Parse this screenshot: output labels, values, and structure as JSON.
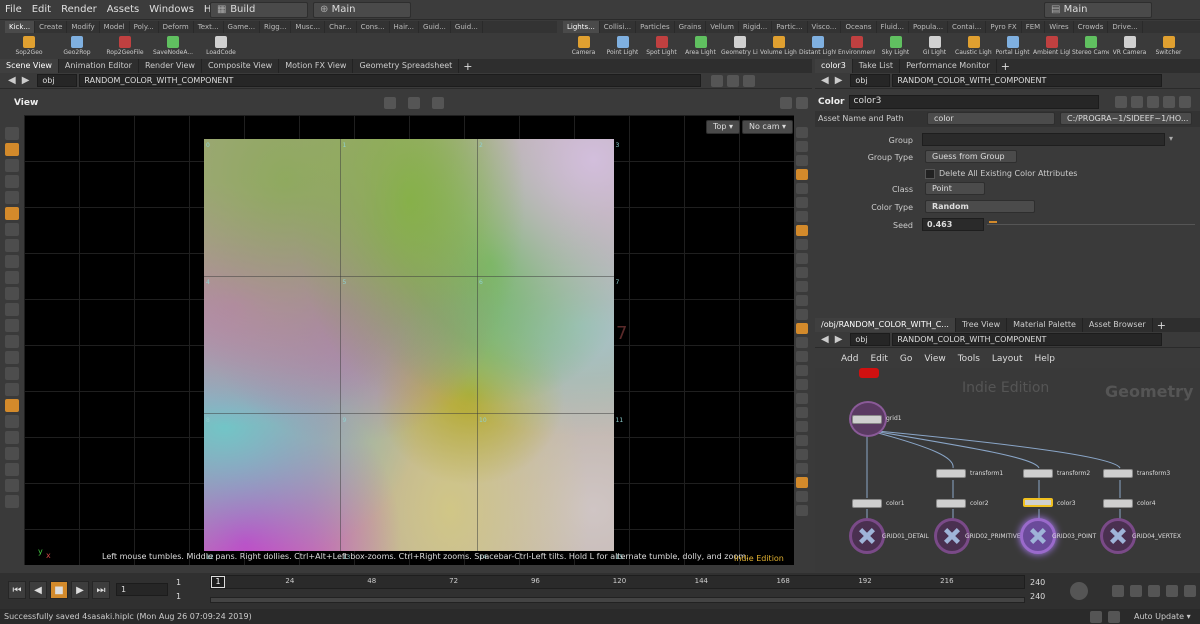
{
  "menu": [
    "File",
    "Edit",
    "Render",
    "Assets",
    "Windows",
    "Help"
  ],
  "desktop": "Build",
  "context": "Main",
  "right_context": "Main",
  "shelf_left": {
    "tabs": [
      "Kick...",
      "Create",
      "Modify",
      "Model",
      "Poly...",
      "Deform",
      "Text...",
      "Game...",
      "Rigg...",
      "Musc...",
      "Char...",
      "Cons...",
      "Hair...",
      "Guid...",
      "Guid..."
    ],
    "tools": [
      "Sop2Geo",
      "Geo2Rop",
      "Rop2GeoFile",
      "SaveNodeA...",
      "LoadCode"
    ]
  },
  "shelf_right": {
    "tabs": [
      "Lights...",
      "Collisi...",
      "Particles",
      "Grains",
      "Vellum",
      "Rigid...",
      "Partic...",
      "Visco...",
      "Oceans",
      "Fluid...",
      "Popula...",
      "Contai...",
      "Pyro FX",
      "FEM",
      "Wires",
      "Crowds",
      "Drive..."
    ],
    "tools": [
      "Camera",
      "Point Light",
      "Spot Light",
      "Area Light",
      "Geometry Light",
      "Volume Light",
      "Distant Light",
      "Environment Light",
      "Sky Light",
      "GI Light",
      "Caustic Light",
      "Portal Light",
      "Ambient Light",
      "Stereo Camera",
      "VR Camera",
      "Switcher"
    ]
  },
  "viewport_tabs": [
    "Scene View",
    "Animation Editor",
    "Render View",
    "Composite View",
    "Motion FX View",
    "Geometry Spreadsheet"
  ],
  "viewport_path": {
    "obj": "obj",
    "node": "RANDOM_COLOR_WITH_COMPONENT"
  },
  "viewport": {
    "label": "View",
    "view_dropdown": "Top",
    "cam_dropdown": "No cam",
    "big_number": "7",
    "hint": "Left mouse tumbles. Middle pans. Right dollies. Ctrl+Alt+Left box-zooms. Ctrl+Right zooms. Spacebar-Ctrl-Left tilts. Hold L for alternate tumble, dolly, and zoom.",
    "edition": "Indie Edition",
    "axis_y": "y",
    "axis_x": "x",
    "point_numbers": [
      "0",
      "1",
      "2",
      "3",
      "4",
      "5",
      "6",
      "7",
      "8",
      "9",
      "10",
      "11",
      "12",
      "13",
      "14",
      "15"
    ]
  },
  "param_tabs": [
    "color3",
    "Take List",
    "Performance Monitor"
  ],
  "param_path": {
    "obj": "obj",
    "node": "RANDOM_COLOR_WITH_COMPONENT"
  },
  "params": {
    "node_type": "Color",
    "node_name": "color3",
    "asset_label": "Asset Name and Path",
    "asset_name": "color",
    "asset_path": "C:/PROGRA~1/SIDEEF~1/HO...",
    "group_label": "Group",
    "group_value": "",
    "group_type_label": "Group Type",
    "group_type": "Guess from Group",
    "delete_attrs": "Delete All Existing Color Attributes",
    "class_label": "Class",
    "class_value": "Point",
    "color_type_label": "Color Type",
    "color_type": "Random",
    "seed_label": "Seed",
    "seed_value": "0.463"
  },
  "network_tabs": [
    "/obj/RANDOM_COLOR_WITH_C...",
    "Tree View",
    "Material Palette",
    "Asset Browser"
  ],
  "network_path": {
    "obj": "obj",
    "node": "RANDOM_COLOR_WITH_COMPONENT"
  },
  "network_menu": [
    "Add",
    "Edit",
    "Go",
    "View",
    "Tools",
    "Layout",
    "Help"
  ],
  "network": {
    "watermark_edition": "Indie Edition",
    "watermark_context": "Geometry",
    "nodes": {
      "grid": "grid1",
      "transform1": "transform1",
      "transform2": "transform2",
      "transform3": "transform3",
      "color1": "color1",
      "color2": "color2",
      "color3": "color3",
      "color4": "color4",
      "out1": "GRID01_DETAIL",
      "out2": "GRID02_PRIMITIVE",
      "out3": "GRID03_POINT",
      "out4": "GRID04_VERTEX"
    }
  },
  "timeline": {
    "current_frame": "1",
    "start": "1",
    "start2": "1",
    "end": "240",
    "end2": "240",
    "ticks": [
      "24",
      "48",
      "72",
      "96",
      "120",
      "144",
      "168",
      "192",
      "216"
    ],
    "marker": "1",
    "auto_update": "Auto Update"
  },
  "status": "Successfully saved 4sasaki.hiplc (Mon Aug 26 07:09:24 2019)"
}
